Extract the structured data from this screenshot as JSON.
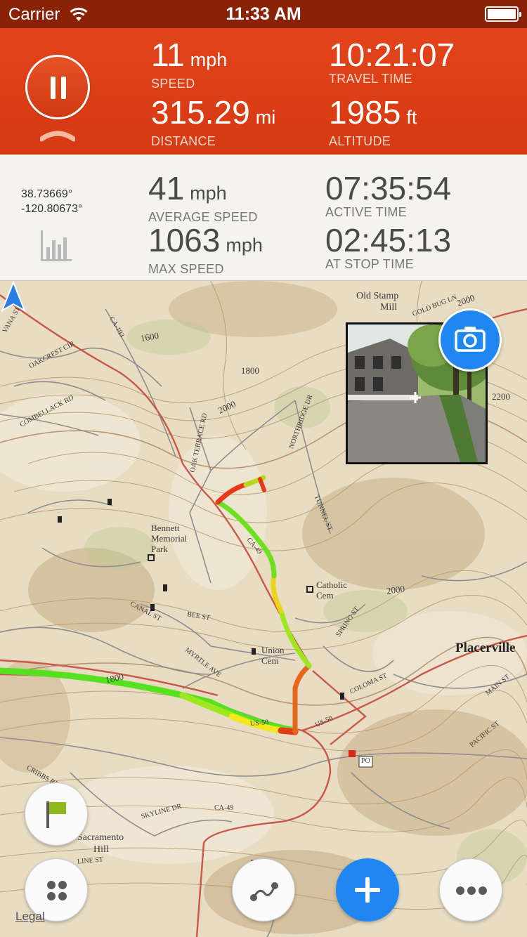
{
  "status_bar": {
    "carrier": "Carrier",
    "time": "11:33 AM"
  },
  "primary_stats": {
    "speed": {
      "value": "11",
      "unit": "mph",
      "label": "SPEED"
    },
    "travel_time": {
      "value": "10:21:07",
      "label": "TRAVEL TIME"
    },
    "distance": {
      "value": "315.29",
      "unit": "mi",
      "label": "DISTANCE"
    },
    "altitude": {
      "value": "1985",
      "unit": "ft",
      "label": "ALTITUDE"
    }
  },
  "secondary_stats": {
    "latitude": "38.73669°",
    "longitude": "-120.80673°",
    "average_speed": {
      "value": "41",
      "unit": "mph",
      "label": "AVERAGE SPEED"
    },
    "active_time": {
      "value": "07:35:54",
      "label": "ACTIVE TIME"
    },
    "max_speed": {
      "value": "1063",
      "unit": "mph",
      "label": "MAX SPEED"
    },
    "at_stop_time": {
      "value": "02:45:13",
      "label": "AT STOP TIME"
    }
  },
  "map": {
    "labels": {
      "old_stamp_mill": "Old Stamp Mill",
      "old_stamp_1": "Old Stamp",
      "old_stamp_2": "Mill",
      "gold_bug_ln": "GOLD BUG LN",
      "c2000_a": "2000",
      "c1600": "1600",
      "c1800_a": "1800",
      "c2000_b": "2000",
      "c2200": "2200",
      "ca193": "CA-193",
      "oakcrest_cir": "OAKCREST CIR",
      "combellack_rd": "COMBELLACK RD",
      "ivana_st": "VANA ST",
      "oak_terrace_rd": "OAK TERRACE RD",
      "northridge_dr": "NORTHRIDGE DR",
      "tunnel_st": "TUNNEL ST",
      "bennett_1": "Bennett",
      "bennett_2": "Memorial",
      "bennett_3": "Park",
      "ca49_a": "CA-49",
      "catholic_1": "Catholic",
      "catholic_2": "Cem",
      "c2000_c": "2000",
      "canal_st": "CANAL ST",
      "bee_st": "BEE ST",
      "spring_st": "SPRING ST",
      "union_1": "Union",
      "union_2": "Cem",
      "placerville": "Placerville",
      "myrtle_ave": "MYRTLE AVE",
      "coloma_st": "COLOMA ST",
      "c1800_b": "1800",
      "us50_a": "US-50",
      "us50_b": "US-50",
      "main_st": "MAIN ST",
      "pacific_st": "PACIFIC ST",
      "po": "PO",
      "cribbs": "CRIBBS RD",
      "skyline_dr": "SKYLINE DR",
      "ca49_b": "CA-49",
      "sacramento_1": "Sacramento",
      "sacramento_2": "Hill",
      "line_st": "LINE ST"
    },
    "legal": "Legal"
  },
  "controls": {
    "pause": "pause-icon",
    "camera": "camera-icon",
    "flag": "flag-icon",
    "menu": "grid-icon",
    "route": "route-icon",
    "add": "plus-icon",
    "more": "ellipsis-icon"
  },
  "colors": {
    "header_red": "#d63a12",
    "status_bar": "#8a2208",
    "accent_blue": "#1f86f2",
    "track_green": "#55e020",
    "track_yellow": "#f2e81c",
    "track_red": "#e6391a",
    "flag_green": "#8fb81c"
  }
}
